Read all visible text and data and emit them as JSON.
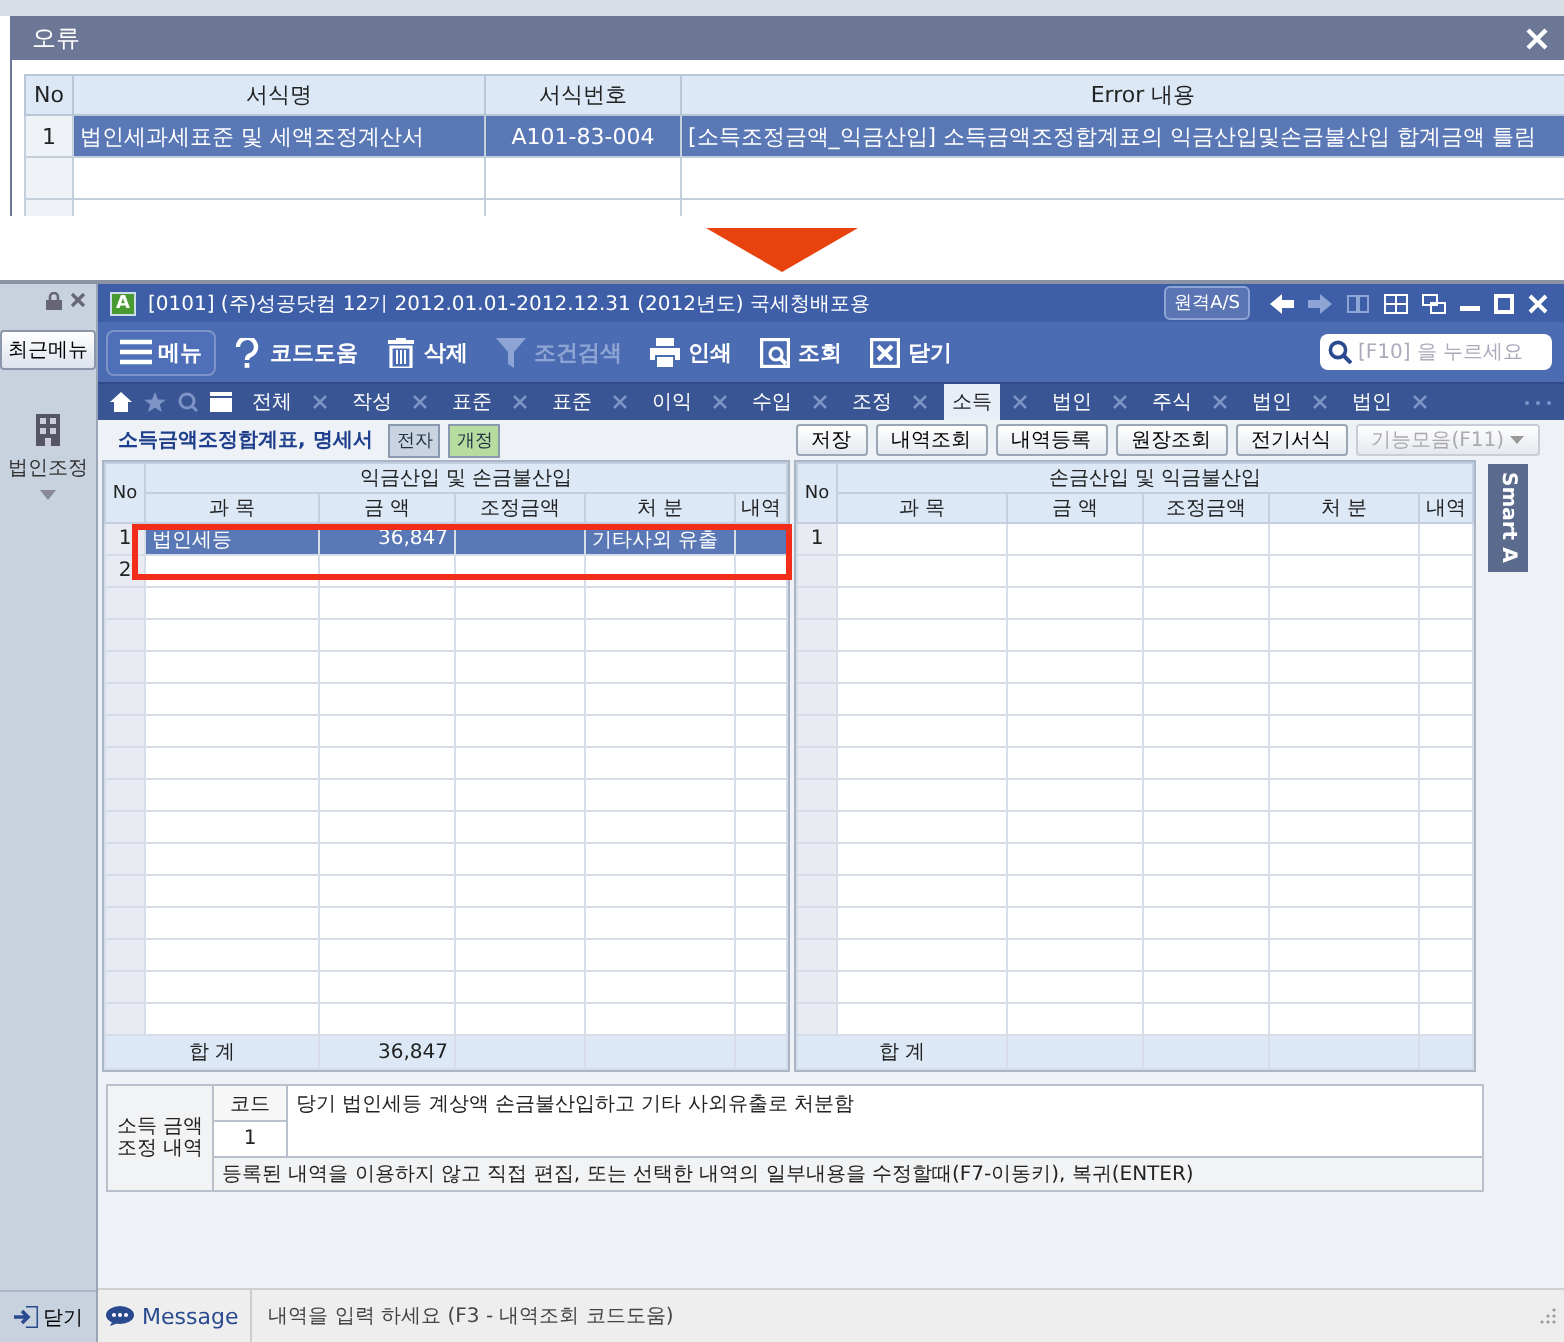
{
  "error_dialog": {
    "title": "오류",
    "columns": [
      "No",
      "서식명",
      "서식번호",
      "Error 내용"
    ],
    "rows": [
      {
        "no": "1",
        "form_name": "법인세과세표준 및 세액조정계산서",
        "form_number": "A101-83-004",
        "error": "[소득조정금액_익금산입] 소득금액조정합계표의 익금산입및손금불산입 합계금액 틀림",
        "selected": true
      }
    ]
  },
  "app": {
    "sidebar": {
      "recent_button": "최근메뉴",
      "items": [
        {
          "label": "법인조정",
          "expanded": false
        }
      ],
      "close_button": "닫기"
    },
    "title_bar": {
      "app_badge": "A",
      "company_info": "[0101] (주)성공닷컴   12기 2012.01.01-2012.12.31 (2012년도) 국세청배포용",
      "remote_button": "원격A/S"
    },
    "toolbar": [
      {
        "kind": "menu",
        "label": "메뉴",
        "disabled": false
      },
      {
        "kind": "help",
        "label": "코드도움",
        "disabled": false
      },
      {
        "kind": "delete",
        "label": "삭제",
        "disabled": false
      },
      {
        "kind": "filter",
        "label": "조건검색",
        "disabled": true
      },
      {
        "kind": "print",
        "label": "인쇄",
        "disabled": false
      },
      {
        "kind": "view",
        "label": "조회",
        "disabled": false
      },
      {
        "kind": "close",
        "label": "닫기",
        "disabled": false
      }
    ],
    "search": {
      "placeholder": "[F10] 을 누르세요"
    },
    "tabs": [
      {
        "label": "전체",
        "selected": false
      },
      {
        "label": "작성",
        "selected": false
      },
      {
        "label": "표준",
        "selected": false
      },
      {
        "label": "표준",
        "selected": false
      },
      {
        "label": "이익",
        "selected": false
      },
      {
        "label": "수입",
        "selected": false
      },
      {
        "label": "조정",
        "selected": false
      },
      {
        "label": "소득",
        "selected": true
      },
      {
        "label": "법인",
        "selected": false
      },
      {
        "label": "주식",
        "selected": false
      },
      {
        "label": "법인",
        "selected": false
      },
      {
        "label": "법인",
        "selected": false
      }
    ],
    "page_title": "소득금액조정합계표, 명세서",
    "badges": [
      {
        "label": "전자",
        "color": "#c9d3e2"
      },
      {
        "label": "개정",
        "color": "#b6dca0"
      }
    ],
    "buttons": [
      {
        "label": "저장",
        "disabled": false
      },
      {
        "label": "내역조회",
        "disabled": false
      },
      {
        "label": "내역등록",
        "disabled": false
      },
      {
        "label": "원장조회",
        "disabled": false
      },
      {
        "label": "전기서식",
        "disabled": false
      },
      {
        "label": "기능모음(F11)",
        "disabled": true
      }
    ],
    "left_table": {
      "no_header": "No",
      "group": "익금산입 및 손금불산입",
      "highlighted": true,
      "columns": [
        "과 목",
        "금 액",
        "조정금액",
        "처 분",
        "내역"
      ],
      "rows": [
        {
          "no": "1",
          "cells": [
            "법인세등",
            "36,847",
            "",
            "기타사외 유출",
            ""
          ],
          "selected": true
        },
        {
          "no": "2",
          "cells": [
            "",
            "",
            "",
            "",
            ""
          ],
          "selected": false
        }
      ],
      "total": {
        "label": "합 계",
        "amount": "36,847"
      }
    },
    "right_table": {
      "no_header": "No",
      "group": "손금산입 및 익금불산입",
      "columns": [
        "과 목",
        "금 액",
        "조정금액",
        "처 분",
        "내역"
      ],
      "rows": [
        {
          "no": "1",
          "cells": [
            "",
            "",
            "",
            "",
            ""
          ],
          "selected": false
        }
      ],
      "total": {
        "label": "합 계"
      }
    },
    "side_panel": "Smart A",
    "adjustment": {
      "label": [
        "소득 금액",
        "조정 내역"
      ],
      "code_header": "코드",
      "code": "1",
      "description": "당기 법인세등 계상액 손금불산입하고 기타 사외유출로 처분함",
      "note": "등록된 내역을 이용하지 않고 직접 편집, 또는 선택한 내역의 일부내용을 수정할때(F7-이동키), 복귀(ENTER)"
    },
    "message": {
      "label": "Message",
      "text": "내역을 입력 하세요 (F3 - 내역조회 코드도움)"
    }
  }
}
